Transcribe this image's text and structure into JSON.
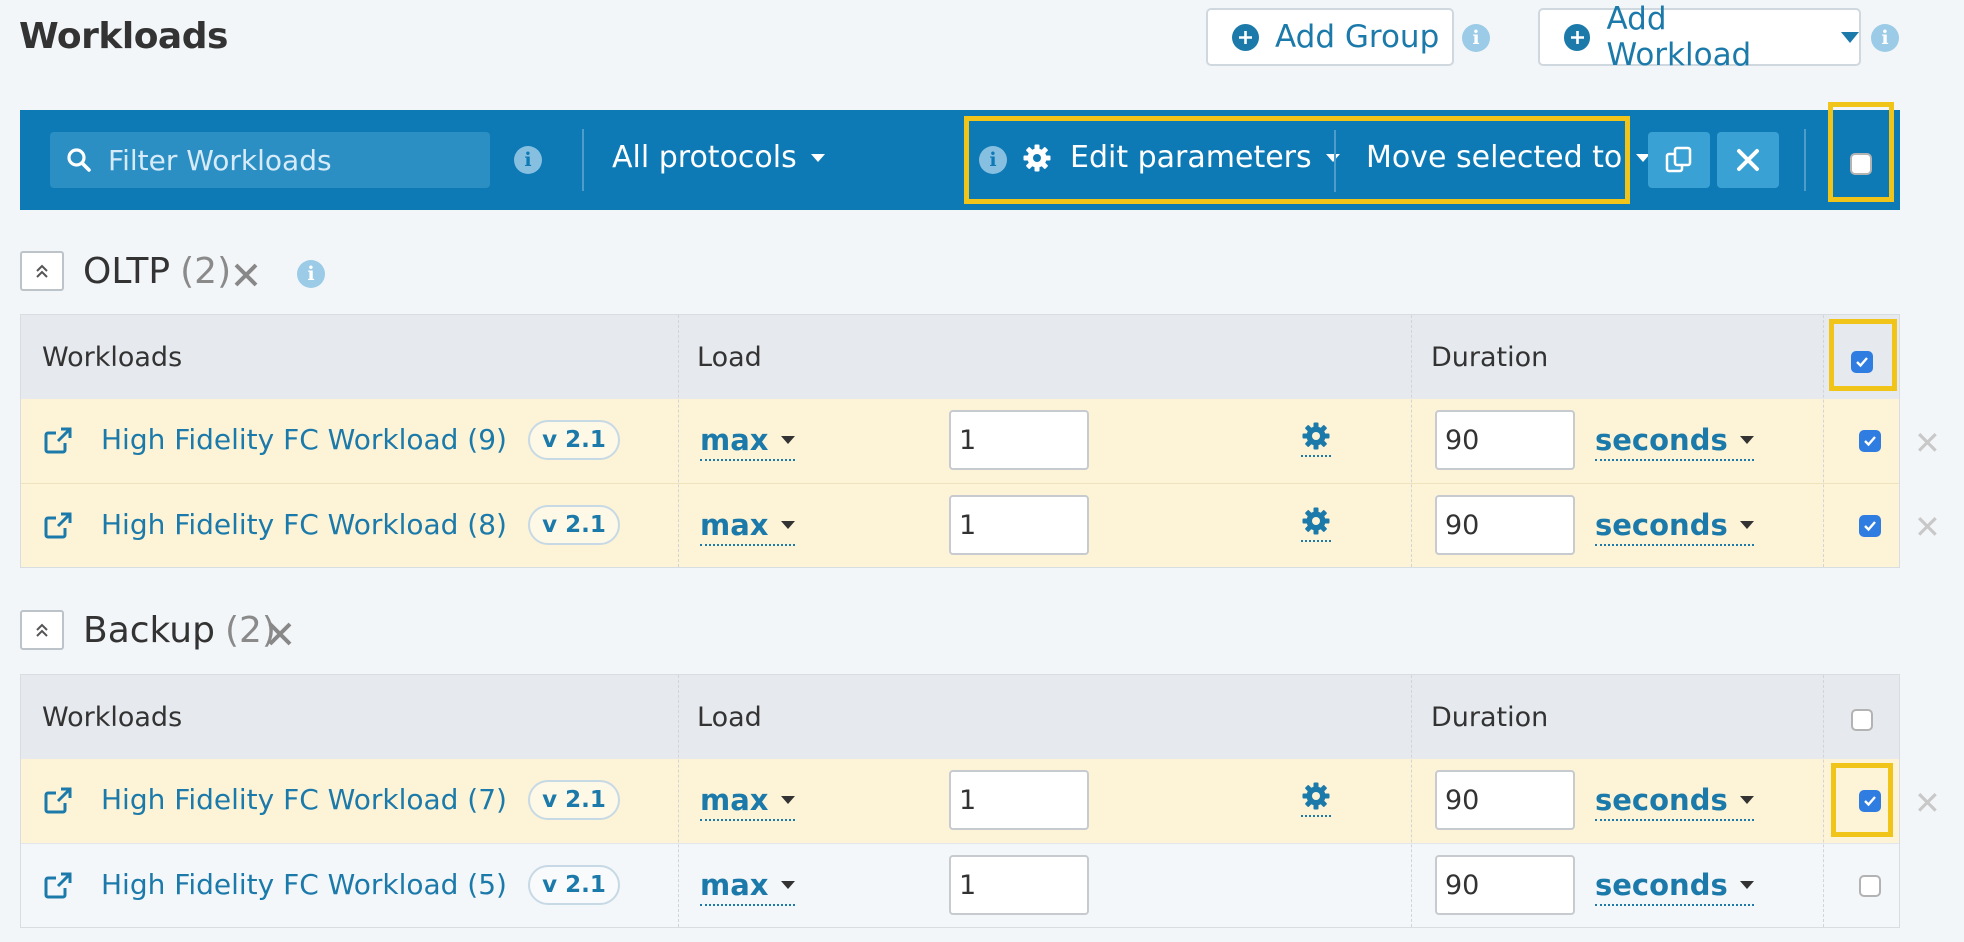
{
  "header": {
    "title": "Workloads",
    "add_group": "Add Group",
    "add_workload": "Add Workload"
  },
  "toolbar": {
    "filter_placeholder": "Filter Workloads",
    "protocols": "All protocols",
    "edit_parameters": "Edit parameters",
    "move_selected": "Move selected to",
    "select_all_checked": false
  },
  "columns": {
    "workloads": "Workloads",
    "load": "Load",
    "duration": "Duration"
  },
  "groups": [
    {
      "name": "OLTP",
      "count": "(2)",
      "header_checked": true,
      "rows": [
        {
          "name": "High Fidelity FC Workload (9)",
          "version": "v 2.1",
          "load_mode": "max",
          "load_value": "1",
          "duration": "90",
          "unit": "seconds",
          "selected": true
        },
        {
          "name": "High Fidelity FC Workload (8)",
          "version": "v 2.1",
          "load_mode": "max",
          "load_value": "1",
          "duration": "90",
          "unit": "seconds",
          "selected": true
        }
      ]
    },
    {
      "name": "Backup",
      "count": "(2)",
      "header_checked": false,
      "rows": [
        {
          "name": "High Fidelity FC Workload (7)",
          "version": "v 2.1",
          "load_mode": "max",
          "load_value": "1",
          "duration": "90",
          "unit": "seconds",
          "selected": true
        },
        {
          "name": "High Fidelity FC Workload (5)",
          "version": "v 2.1",
          "load_mode": "max",
          "load_value": "1",
          "duration": "90",
          "unit": "seconds",
          "selected": false
        }
      ]
    }
  ],
  "colors": {
    "toolbar": "#0e7ab5",
    "link": "#1c7aaa",
    "highlight": "#f0c419",
    "selected_row": "#fdf4d8",
    "checkbox": "#2f7de1"
  }
}
